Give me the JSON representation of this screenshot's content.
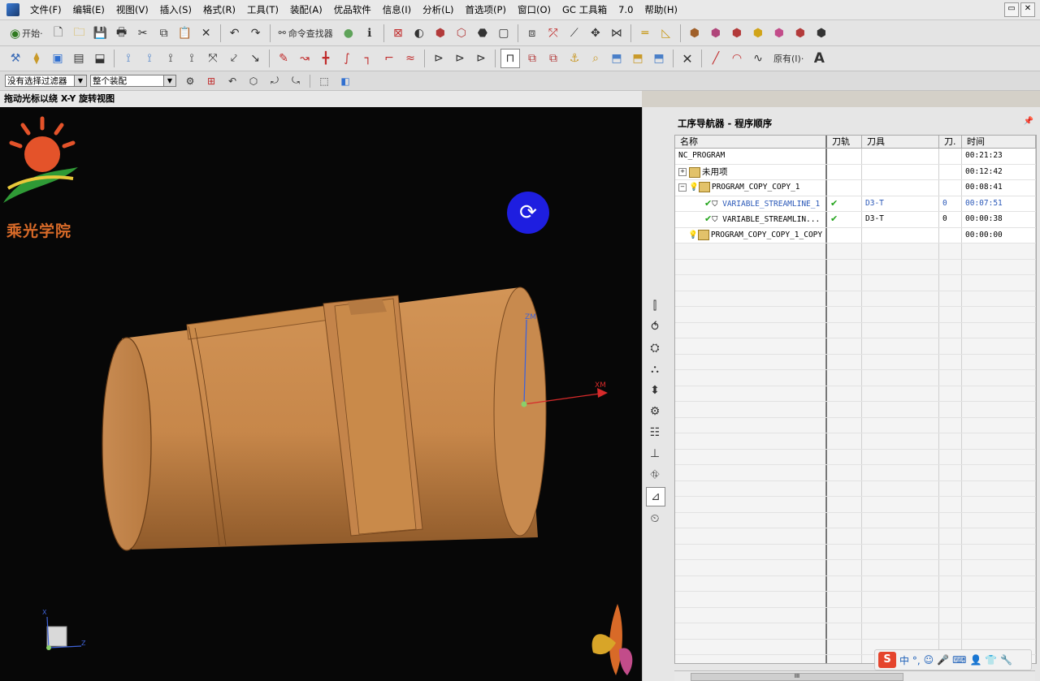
{
  "menubar": {
    "items": [
      "文件(F)",
      "编辑(E)",
      "视图(V)",
      "插入(S)",
      "格式(R)",
      "工具(T)",
      "装配(A)",
      "优品软件",
      "信息(I)",
      "分析(L)",
      "首选项(P)",
      "窗口(O)",
      "GC 工具箱",
      "7.0",
      "帮助(H)"
    ]
  },
  "toolbar": {
    "start_label": "开始·",
    "command_finder_label": "命令查找器",
    "snap_label": "原有(I)·"
  },
  "selection_bar": {
    "filter_value": "没有选择过滤器",
    "scope_value": "整个装配"
  },
  "cue_line": "拖动光标以绕 X-Y 旋转视图",
  "viewport": {
    "logo_text": "乘光学院",
    "axis_x_label": "XM",
    "axis_z_label": "ZM",
    "triad_x": "X",
    "triad_z": "Z",
    "model_color": "#c98a4a",
    "background_color": "#070707"
  },
  "navigator": {
    "title": "工序导航器 - 程序顺序",
    "columns": [
      "名称",
      "刀轨",
      "刀具",
      "刀.",
      "时间"
    ],
    "rows": [
      {
        "name": "NC_PROGRAM",
        "path": "",
        "tool": "",
        "num": "",
        "time": "00:21:23",
        "indent": 0,
        "kind": "root"
      },
      {
        "name": "未用项",
        "path": "",
        "tool": "",
        "num": "",
        "time": "00:12:42",
        "indent": 1,
        "kind": "group"
      },
      {
        "name": "PROGRAM_COPY_COPY_1",
        "path": "",
        "tool": "",
        "num": "",
        "time": "00:08:41",
        "indent": 1,
        "kind": "program"
      },
      {
        "name": "VARIABLE_STREAMLINE_1",
        "path": "✔",
        "tool": "D3-T",
        "num": "0",
        "time": "00:07:51",
        "indent": 3,
        "kind": "op",
        "highlight": true
      },
      {
        "name": "VARIABLE_STREAMLIN...",
        "path": "✔",
        "tool": "D3-T",
        "num": "0",
        "time": "00:00:38",
        "indent": 3,
        "kind": "op"
      },
      {
        "name": "PROGRAM_COPY_COPY_1_COPY",
        "path": "",
        "tool": "",
        "num": "",
        "time": "00:00:00",
        "indent": 1,
        "kind": "program"
      }
    ],
    "scroll_label": "III"
  },
  "ime": {
    "logo": "S",
    "text": "中 °,"
  }
}
